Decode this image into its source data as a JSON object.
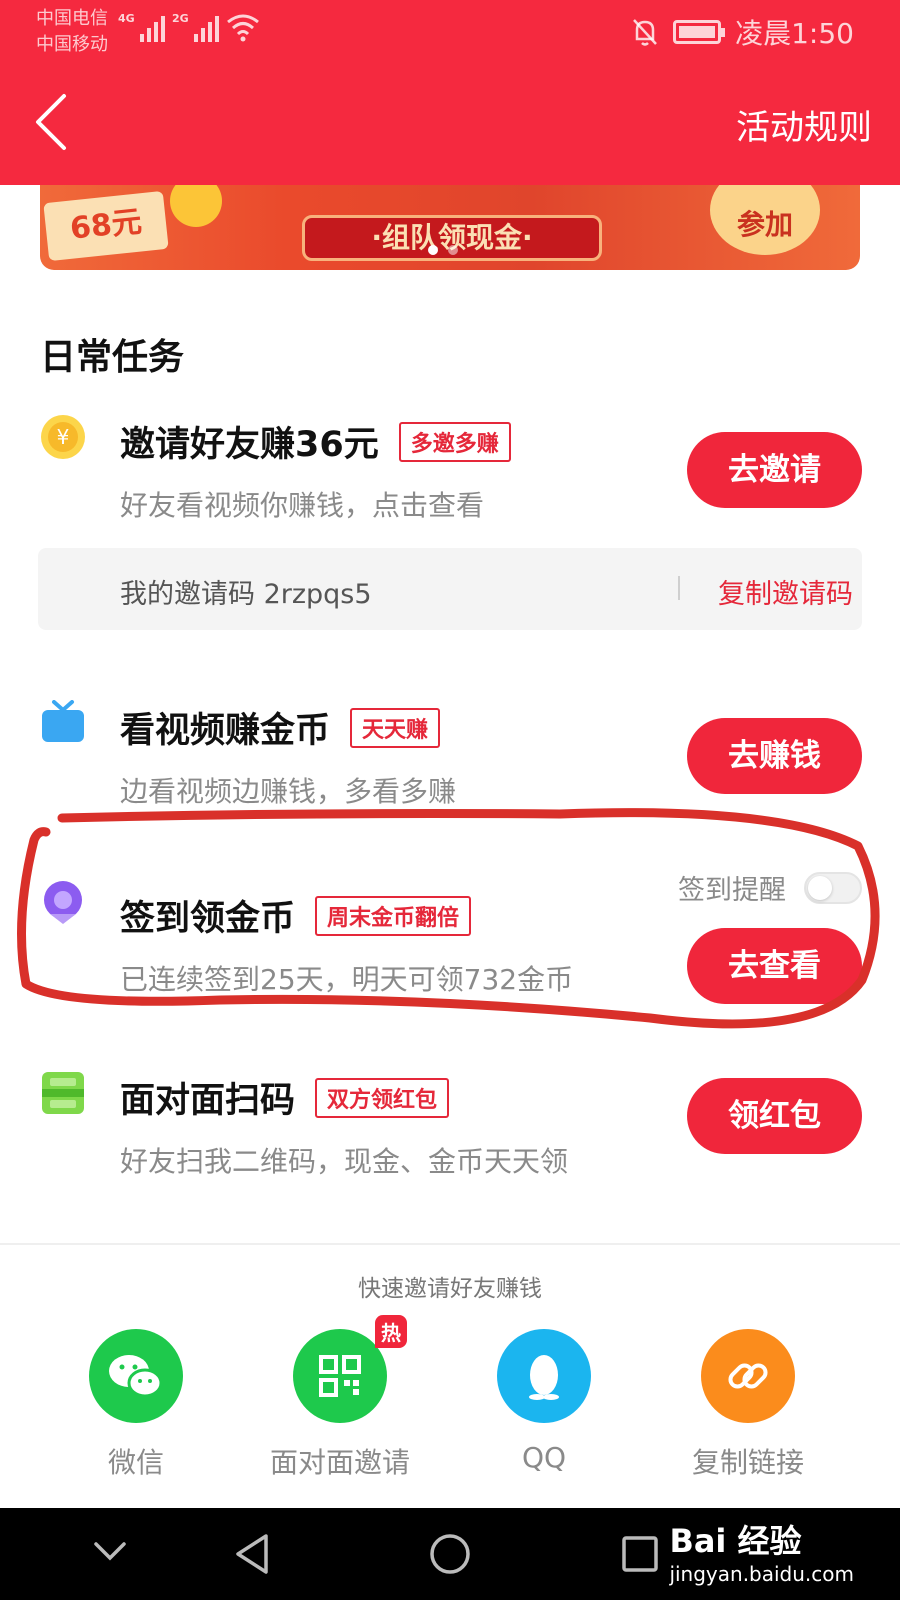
{
  "status_bar": {
    "carrier_1": "中国电信",
    "carrier_2": "中国移动",
    "net_1": "4G",
    "net_2": "2G",
    "time": "凌晨1:50"
  },
  "header": {
    "back_icon": "chevron-left-icon",
    "rules_label": "活动规则",
    "background": "#f5293f"
  },
  "banner": {
    "amount_label": "68元",
    "team_label": "·组队领现金·",
    "join_label": "参加"
  },
  "section_title": "日常任务",
  "tasks": [
    {
      "icon": "yuan-coin-icon",
      "title": "邀请好友赚36元",
      "tag": "多邀多赚",
      "subtitle": "好友看视频你赚钱，点击查看",
      "button": "去邀请"
    },
    {
      "icon": "tv-icon",
      "title": "看视频赚金币",
      "tag": "天天赚",
      "subtitle": "边看视频边赚钱，多看多赚",
      "button": "去赚钱"
    },
    {
      "icon": "location-pin-icon",
      "title": "签到领金币",
      "tag": "周末金币翻倍",
      "subtitle": "已连续签到25天，明天可领732金币",
      "button": "去查看",
      "remind_label": "签到提醒",
      "remind_on": false
    },
    {
      "icon": "scan-code-icon",
      "title": "面对面扫码",
      "tag": "双方领红包",
      "subtitle": "好友扫我二维码，现金、金币天天领",
      "button": "领红包"
    }
  ],
  "invite_code": {
    "text": "我的邀请码 2rzpqs5",
    "copy_label": "复制邀请码"
  },
  "share": {
    "title": "快速邀请好友赚钱",
    "items": [
      {
        "label": "微信",
        "icon": "wechat-icon",
        "color": "#1ec94c"
      },
      {
        "label": "面对面邀请",
        "icon": "qr-code-icon",
        "color": "#1ec94c",
        "badge": "热"
      },
      {
        "label": "QQ",
        "icon": "qq-penguin-icon",
        "color": "#1bb5ef"
      },
      {
        "label": "复制链接",
        "icon": "link-icon",
        "color": "#fb8c1c"
      }
    ]
  },
  "watermark": {
    "line1": "Bai 经验",
    "line2": "jingyan.baidu.com"
  },
  "colors": {
    "accent": "#f0263b",
    "annotation": "#d9302a"
  }
}
